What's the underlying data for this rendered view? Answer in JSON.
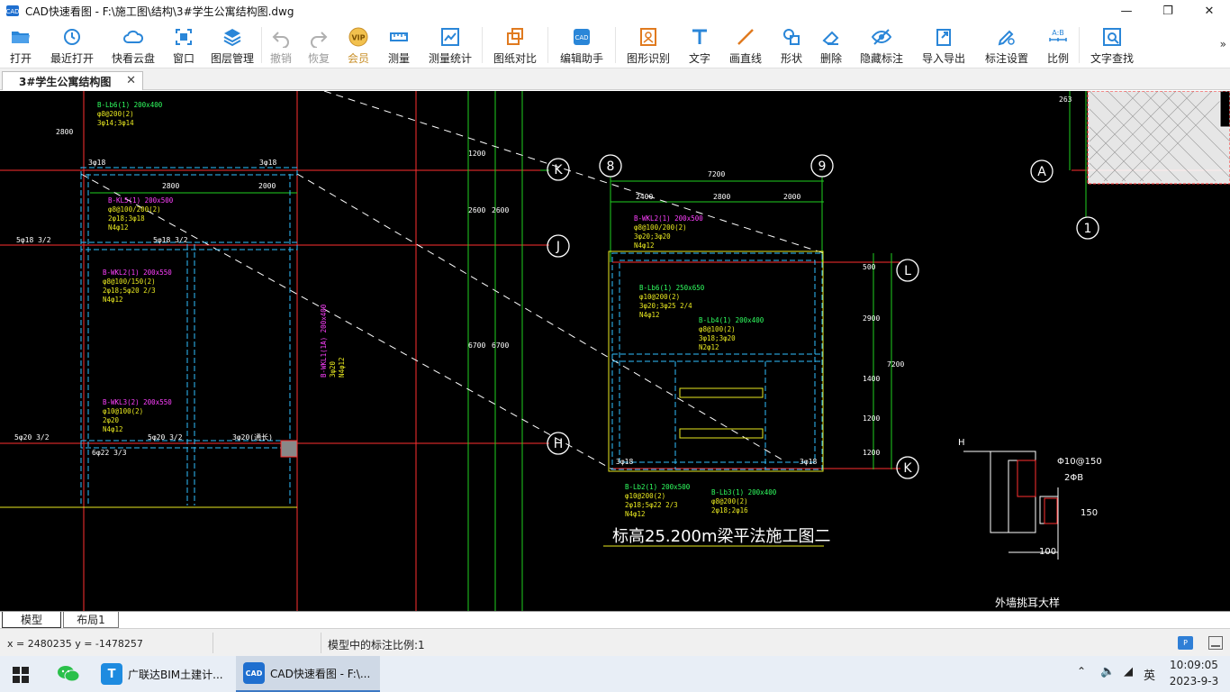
{
  "window": {
    "title": "CAD快速看图 - F:\\施工图\\结构\\3#学生公寓结构图.dwg",
    "minimize": "—",
    "maximize": "❐",
    "close": "✕"
  },
  "toolbar": {
    "items": [
      {
        "label": "打开",
        "icon": "folder-open-icon"
      },
      {
        "label": "最近打开",
        "icon": "history-icon"
      },
      {
        "label": "快看云盘",
        "icon": "cloud-icon"
      },
      {
        "label": "窗口",
        "icon": "window-icon"
      },
      {
        "label": "图层管理",
        "icon": "layers-icon"
      },
      {
        "label": "撤销",
        "icon": "undo-icon"
      },
      {
        "label": "恢复",
        "icon": "redo-icon"
      },
      {
        "label": "会员",
        "icon": "vip-icon"
      },
      {
        "label": "测量",
        "icon": "ruler-icon"
      },
      {
        "label": "测量统计",
        "icon": "measure-stats-icon"
      },
      {
        "label": "图纸对比",
        "icon": "compare-icon"
      },
      {
        "label": "编辑助手",
        "icon": "edit-assistant-icon"
      },
      {
        "label": "图形识别",
        "icon": "shape-recognize-icon"
      },
      {
        "label": "文字",
        "icon": "text-icon"
      },
      {
        "label": "画直线",
        "icon": "line-icon"
      },
      {
        "label": "形状",
        "icon": "shape-icon"
      },
      {
        "label": "删除",
        "icon": "eraser-icon"
      },
      {
        "label": "隐藏标注",
        "icon": "hide-icon"
      },
      {
        "label": "导入导出",
        "icon": "import-export-icon"
      },
      {
        "label": "标注设置",
        "icon": "annotation-settings-icon"
      },
      {
        "label": "比例",
        "icon": "scale-icon"
      },
      {
        "label": "文字查找",
        "icon": "text-search-icon"
      }
    ],
    "more": "»"
  },
  "doc_tab": {
    "label": "3#学生公寓结构图",
    "close": "✕"
  },
  "drawing": {
    "axis_labels": [
      "K",
      "J",
      "H",
      "8",
      "9",
      "A",
      "1",
      "L",
      "K"
    ],
    "dims_top": [
      "2800",
      "2000",
      "7200",
      "2400",
      "2800",
      "2000"
    ],
    "dims_right": [
      "500",
      "2900",
      "1400",
      "1200",
      "1200",
      "7200"
    ],
    "dims_vertical": [
      "2800",
      "1200",
      "2600",
      "6700",
      "2600",
      "6700",
      "263"
    ],
    "beam_labels_left": [
      "B-Lb6(1) 200x400",
      "φ8@200(2)",
      "3φ14;3φ14",
      "B-KL5(1) 200x500",
      "φ8@100/200(2)",
      "2φ18;3φ18",
      "N4φ12",
      "B-WKL2(1) 200x550",
      "φ8@100/150(2)",
      "2φ18;5φ20 2/3",
      "N4φ12",
      "B-WKL3(2) 200x550",
      "φ10@100(2)",
      "2φ20",
      "N4φ12",
      "B-WKL1(1A) 200x400",
      "3φ20",
      "N4φ12"
    ],
    "beam_labels_right": [
      "B-WKL2(1) 200x500",
      "φ8@100/200(2)",
      "3φ20;3φ20",
      "N4φ12",
      "B-Lb6(1) 250x650",
      "φ10@200(2)",
      "3φ20;3φ25 2/4",
      "N4φ12",
      "B-Lb4(1) 200x400",
      "φ8@100(2)",
      "3φ18;3φ20",
      "N2φ12",
      "B-Lb2(1) 200x500",
      "φ10@200(2)",
      "2φ18;5φ22 2/3",
      "N4φ12",
      "B-Lb3(1) 200x400",
      "φ8@200(2)",
      "2φ18;2φ16"
    ],
    "rebar_labels": [
      "5φ18 3/2",
      "5φ18 3/2",
      "5φ20 3/2",
      "5φ20 3/2",
      "3φ18",
      "3φ18",
      "6φ22 3/3",
      "3φ20(通长)",
      "3φ18",
      "3φ18"
    ],
    "plan_title": "标高25.200m梁平法施工图二",
    "detail_title": "外墙挑耳大样",
    "detail_labels": [
      "H",
      "Φ10@150",
      "2ΦB",
      "150",
      "100"
    ]
  },
  "sheet_tabs": [
    {
      "label": "模型",
      "active": true
    },
    {
      "label": "布局1",
      "active": false
    }
  ],
  "status": {
    "coords": "x = 2480235  y = -1478257",
    "scale_text": "模型中的标注比例:1"
  },
  "taskbar": {
    "apps": [
      {
        "label": "",
        "icon": "wechat-icon"
      },
      {
        "label": "广联达BIM土建计...",
        "icon": "glodon-icon"
      },
      {
        "label": "CAD快速看图 - F:\\...",
        "icon": "cad-icon"
      }
    ],
    "ime": "英",
    "time": "10:09:05",
    "date": "2023-9-3"
  }
}
